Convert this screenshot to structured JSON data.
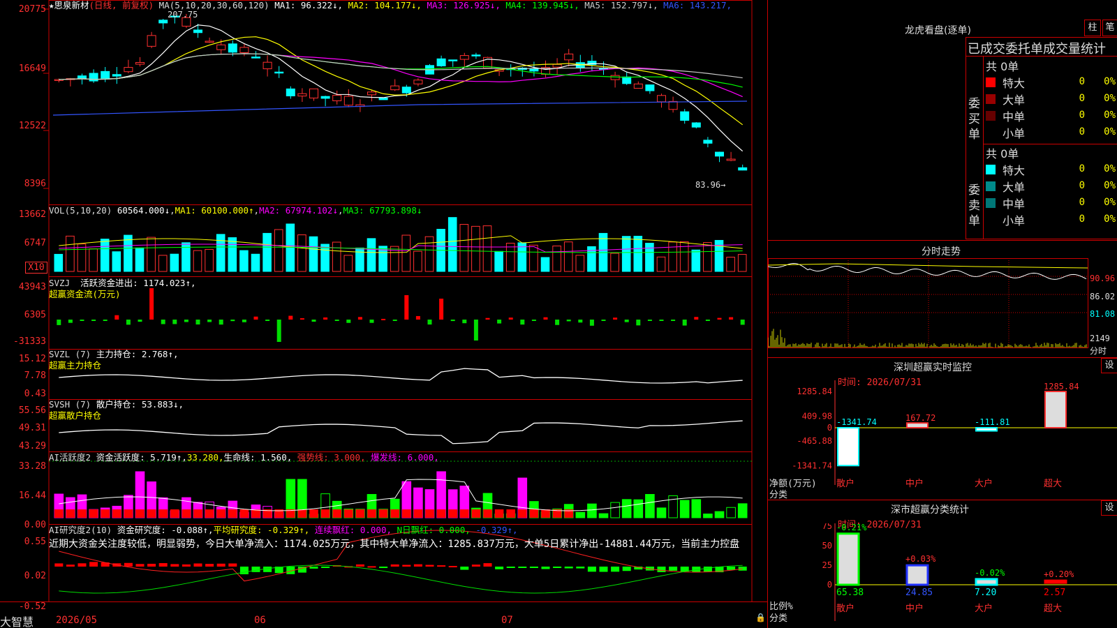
{
  "stock": {
    "name": "★思泉新材",
    "mode": "(日线, 前复权)",
    "ma_label": "MA(5,10,20,30,60,120)",
    "ma": [
      {
        "k": "MA1",
        "v": "96.322↓",
        "c": "#ffffff"
      },
      {
        "k": "MA2",
        "v": "104.177↓",
        "c": "#ffff00"
      },
      {
        "k": "MA3",
        "v": "126.925↓",
        "c": "#ff00ff"
      },
      {
        "k": "MA4",
        "v": "139.945↓",
        "c": "#00ff00"
      },
      {
        "k": "MA5",
        "v": "152.797↓",
        "c": "#cccccc"
      },
      {
        "k": "MA6",
        "v": "143.217",
        "c": "#3355ff"
      }
    ],
    "high_label": "207.75",
    "low_label": "83.96→",
    "high_price": 207.75,
    "low_price": 83.96
  },
  "price_axis": [
    "20775",
    "16649",
    "12522",
    "8396"
  ],
  "vol": {
    "label": "VOL(5,10,20)",
    "value": "60564.000↓",
    "ma1": "MA1: 60100.000↑",
    "ma2": "MA2: 67974.102↓",
    "ma3": "MA3: 67793.898↓",
    "axis": [
      "13662",
      "6747"
    ],
    "unit": "X10"
  },
  "svzj": {
    "label": "SVZJ",
    "name": "活跃资金进出:",
    "value": "1174.023↑,",
    "sub": "超赢资金流(万元)",
    "axis": [
      "43943",
      "6305",
      "-31333"
    ]
  },
  "svzl": {
    "label": "SVZL (7)",
    "name": "主力持仓:",
    "value": "2.768↑,",
    "sub": "超赢主力持仓",
    "axis": [
      "15.12",
      "7.78",
      "0.43"
    ]
  },
  "svsh": {
    "label": "SVSH (7)",
    "name": "散户持仓:",
    "value": "53.883↓,",
    "sub": "超赢散户持仓",
    "axis": [
      "55.56",
      "49.31",
      "43.29"
    ]
  },
  "ai1": {
    "label": "AI活跃度2",
    "name": "资金活跃度:",
    "value": "5.719↑,",
    "v2": "33.280,",
    "life": "生命线: 1.560,",
    "strong": "强势线: 3.000,",
    "burst": "爆发线: 6.000,",
    "axis": [
      "33.28",
      "16.44",
      "0.00"
    ]
  },
  "ai2": {
    "label": "AI研究度2(10)",
    "name": "资金研究度:",
    "value": "-0.088↑,",
    "avg": "平均研究度: -0.329↑,",
    "cont": "连续飘红: 0.000,",
    "nday": "N日飘红: 0.000,",
    "last": "-0.329↑,",
    "note": "近期大资金关注度较低，明显弱势，今日大单净流入：1174.025万元，其中特大单净流入：1285.837万元，大单5日累计净出-14881.44万元，当前主力控盘",
    "axis": [
      "0.55",
      "0.02",
      "-0.52"
    ]
  },
  "dates": [
    "2026/05",
    "06",
    "07"
  ],
  "brand": "大智慧",
  "lhkp": {
    "title": "龙虎看盘(逐单)",
    "btn1": "柱",
    "btn2": "笔",
    "head": "已成交委托单成交量统计",
    "buy": {
      "label": "委买单",
      "total": "共 0单",
      "rows": [
        {
          "n": "特大",
          "c": "#ff0000",
          "v": "0",
          "p": "0%"
        },
        {
          "n": "大单",
          "c": "#990000",
          "v": "0",
          "p": "0%"
        },
        {
          "n": "中单",
          "c": "#660000",
          "v": "0",
          "p": "0%"
        },
        {
          "n": "小单",
          "c": "",
          "v": "0",
          "p": "0%"
        }
      ]
    },
    "sell": {
      "label": "委卖单",
      "total": "共 0单",
      "rows": [
        {
          "n": "特大",
          "c": "#00ffff",
          "v": "0",
          "p": "0%"
        },
        {
          "n": "大单",
          "c": "#008b8b",
          "v": "0",
          "p": "0%"
        },
        {
          "n": "中单",
          "c": "#007777",
          "v": "0",
          "p": "0%"
        },
        {
          "n": "小单",
          "c": "",
          "v": "0",
          "p": "0%"
        }
      ]
    }
  },
  "intraday": {
    "title": "分时走势",
    "axis": [
      "90.96",
      "86.02",
      "81.08"
    ],
    "vol": "2149",
    "unit": "分时"
  },
  "sz_monitor": {
    "title": "深圳超赢实时监控",
    "btn": "设",
    "time": "时间: 2026/07/31",
    "axis": [
      "1285.84",
      "409.98",
      "0",
      "-465.88",
      "-1341.74"
    ],
    "bars": [
      {
        "cat": "散户",
        "v": -1341.74,
        "label": "-1341.74"
      },
      {
        "cat": "中户",
        "v": 167.72,
        "label": "167.72"
      },
      {
        "cat": "大户",
        "v": -111.81,
        "label": "-111.81"
      },
      {
        "cat": "超大",
        "v": 1285.84,
        "label": "1285.84"
      }
    ],
    "ylab1": "净额(万元)",
    "ylab2": "分类"
  },
  "sz_class": {
    "title": "深市超赢分类统计",
    "btn": "设",
    "time": "时间: 2026/07/31",
    "axis": [
      "75",
      "50",
      "25",
      "0"
    ],
    "bars": [
      {
        "cat": "散户",
        "v": 65.38,
        "top": "-0.21%",
        "label": "65.38",
        "c": "#00ff00"
      },
      {
        "cat": "中户",
        "v": 24.85,
        "top": "+0.03%",
        "label": "24.85",
        "c": "#2233ff"
      },
      {
        "cat": "大户",
        "v": 7.2,
        "top": "-0.02%",
        "label": "7.20",
        "c": "#00ffff"
      },
      {
        "cat": "超大",
        "v": 2.57,
        "top": "+0.20%",
        "label": "2.57",
        "c": "#ff0000"
      }
    ],
    "ylab1": "比例%",
    "ylab2": "分类"
  }
}
